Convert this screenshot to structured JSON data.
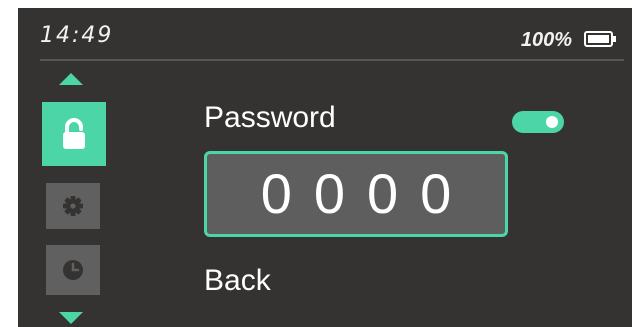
{
  "status_bar": {
    "time": "14:49",
    "battery_percent": "100%",
    "battery_level": 1.0
  },
  "side_menu": {
    "items": [
      {
        "icon": "lock-icon",
        "selected": true
      },
      {
        "icon": "gear-icon",
        "selected": false
      },
      {
        "icon": "clock-icon",
        "selected": false
      }
    ]
  },
  "password": {
    "label": "Password",
    "enabled": true,
    "digits": [
      "0",
      "0",
      "0",
      "0"
    ]
  },
  "back": {
    "label": "Back"
  },
  "colors": {
    "accent": "#4cd6a8",
    "background": "#353331",
    "inactive_item": "#606060",
    "pin_field": "#5e5e5e"
  }
}
